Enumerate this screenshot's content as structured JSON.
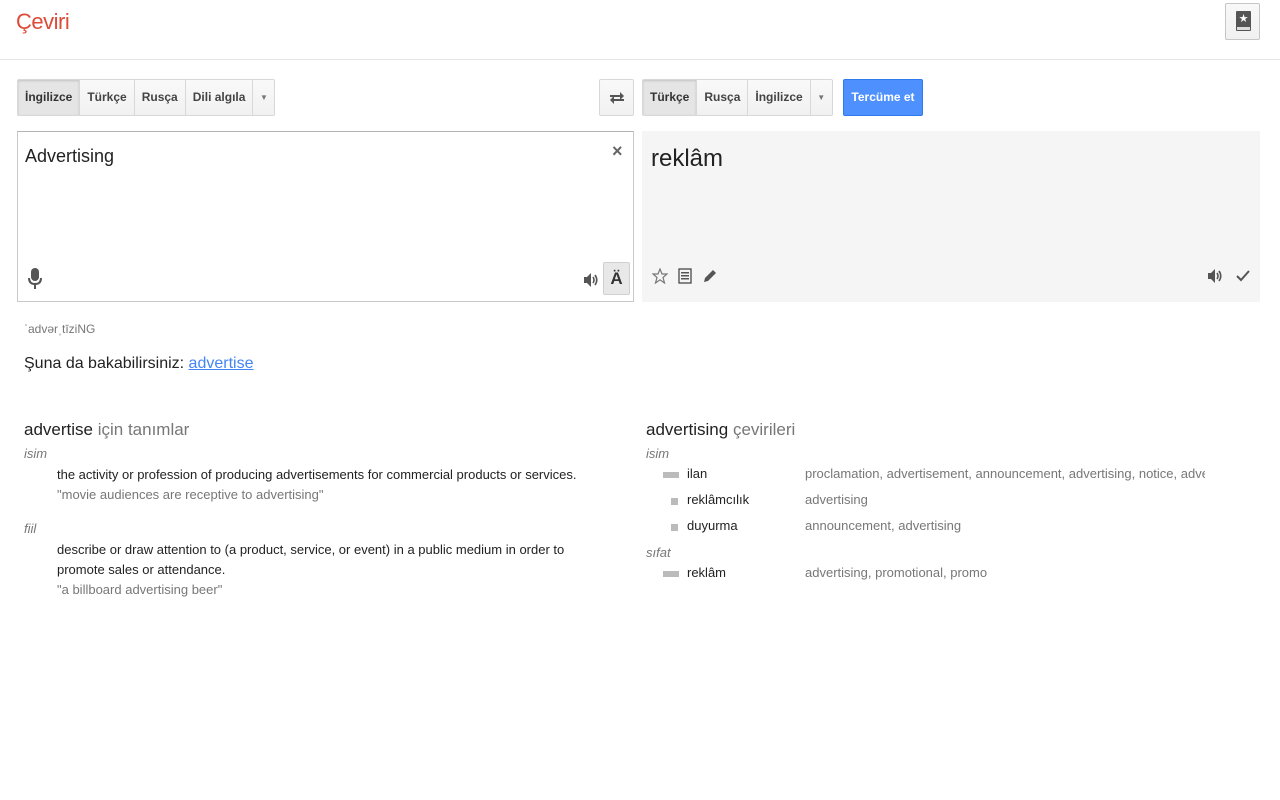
{
  "app": {
    "title": "Çeviri"
  },
  "source_langs": {
    "items": [
      "İngilizce",
      "Türkçe",
      "Rusça",
      "Dili algıla"
    ],
    "dropdown": "▼"
  },
  "target_langs": {
    "items": [
      "Türkçe",
      "Rusça",
      "İngilizce"
    ],
    "dropdown": "▼"
  },
  "translate_button": "Tercüme et",
  "source": {
    "text": "Advertising",
    "clear": "×",
    "keyboard": "Ä"
  },
  "target": {
    "text": "reklâm"
  },
  "transliteration": "ˈadvərˌtīziNG",
  "see_also": {
    "prefix": "Şuna da bakabilirsiniz: ",
    "link": "advertise"
  },
  "definitions": {
    "title_word": "advertise",
    "title_suffix": " için tanımlar",
    "groups": [
      {
        "pos": "isim",
        "definition": "the activity or profession of producing advertisements for commercial products or services.",
        "example": "\"movie audiences are receptive to advertising\""
      },
      {
        "pos": "fiil",
        "definition": "describe or draw attention to (a product, service, or event) in a public medium in order to promote sales or attendance.",
        "example": "\"a billboard advertising beer\""
      }
    ]
  },
  "translations": {
    "title_word": "advertising",
    "title_suffix": " çevirileri",
    "groups": [
      {
        "pos": "isim",
        "rows": [
          {
            "word": "ilan",
            "back": "proclamation, advertisement, announcement, advertising, notice, advert",
            "freq": "high"
          },
          {
            "word": "reklâmcılık",
            "back": "advertising",
            "freq": "low"
          },
          {
            "word": "duyurma",
            "back": "announcement, advertising",
            "freq": "low"
          }
        ]
      },
      {
        "pos": "sıfat",
        "rows": [
          {
            "word": "reklâm",
            "back": "advertising, promotional, promo",
            "freq": "high"
          }
        ]
      }
    ]
  }
}
